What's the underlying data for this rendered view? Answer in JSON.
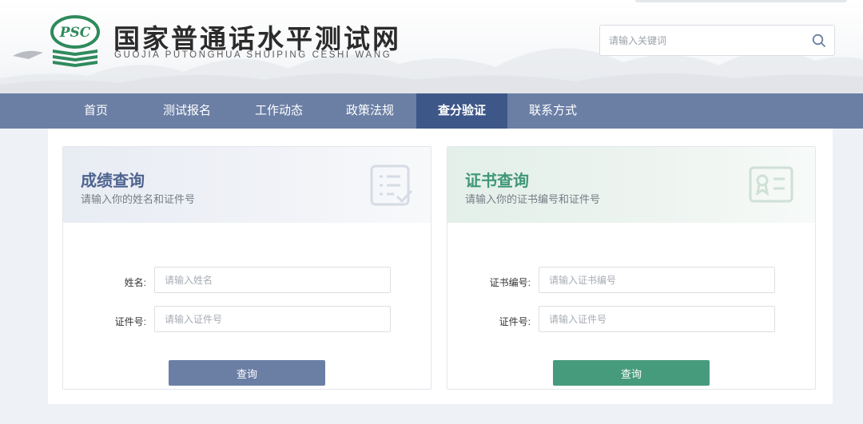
{
  "header": {
    "title": "国家普通话水平测试网",
    "pinyin": "GUOJIA PUTONGHUA SHUIPING CESHI WANG",
    "logo_text": "PSC",
    "search": {
      "placeholder": "请输入关键词",
      "value": "",
      "icon": "search-icon"
    }
  },
  "nav": {
    "items": [
      {
        "label": "首页"
      },
      {
        "label": "测试报名"
      },
      {
        "label": "工作动态"
      },
      {
        "label": "政策法规"
      },
      {
        "label": "查分验证",
        "active": true
      },
      {
        "label": "联系方式"
      }
    ]
  },
  "score_query": {
    "title": "成绩查询",
    "subtitle": "请输入你的姓名和证件号",
    "icon": "checklist-icon",
    "name_label": "姓名:",
    "name_placeholder": "请输入姓名",
    "id_label": "证件号:",
    "id_placeholder": "请输入证件号",
    "button": "查询"
  },
  "cert_query": {
    "title": "证书查询",
    "subtitle": "请输入你的证书编号和证件号",
    "icon": "certificate-icon",
    "cert_label": "证书编号:",
    "cert_placeholder": "请输入证书编号",
    "id_label": "证件号:",
    "id_placeholder": "请输入证件号",
    "button": "查询"
  },
  "colors": {
    "nav": "#6b7fa5",
    "nav_active": "#3e5789",
    "score_accent": "#4e6390",
    "cert_accent": "#3f9777",
    "cert_button": "#479b7d"
  }
}
